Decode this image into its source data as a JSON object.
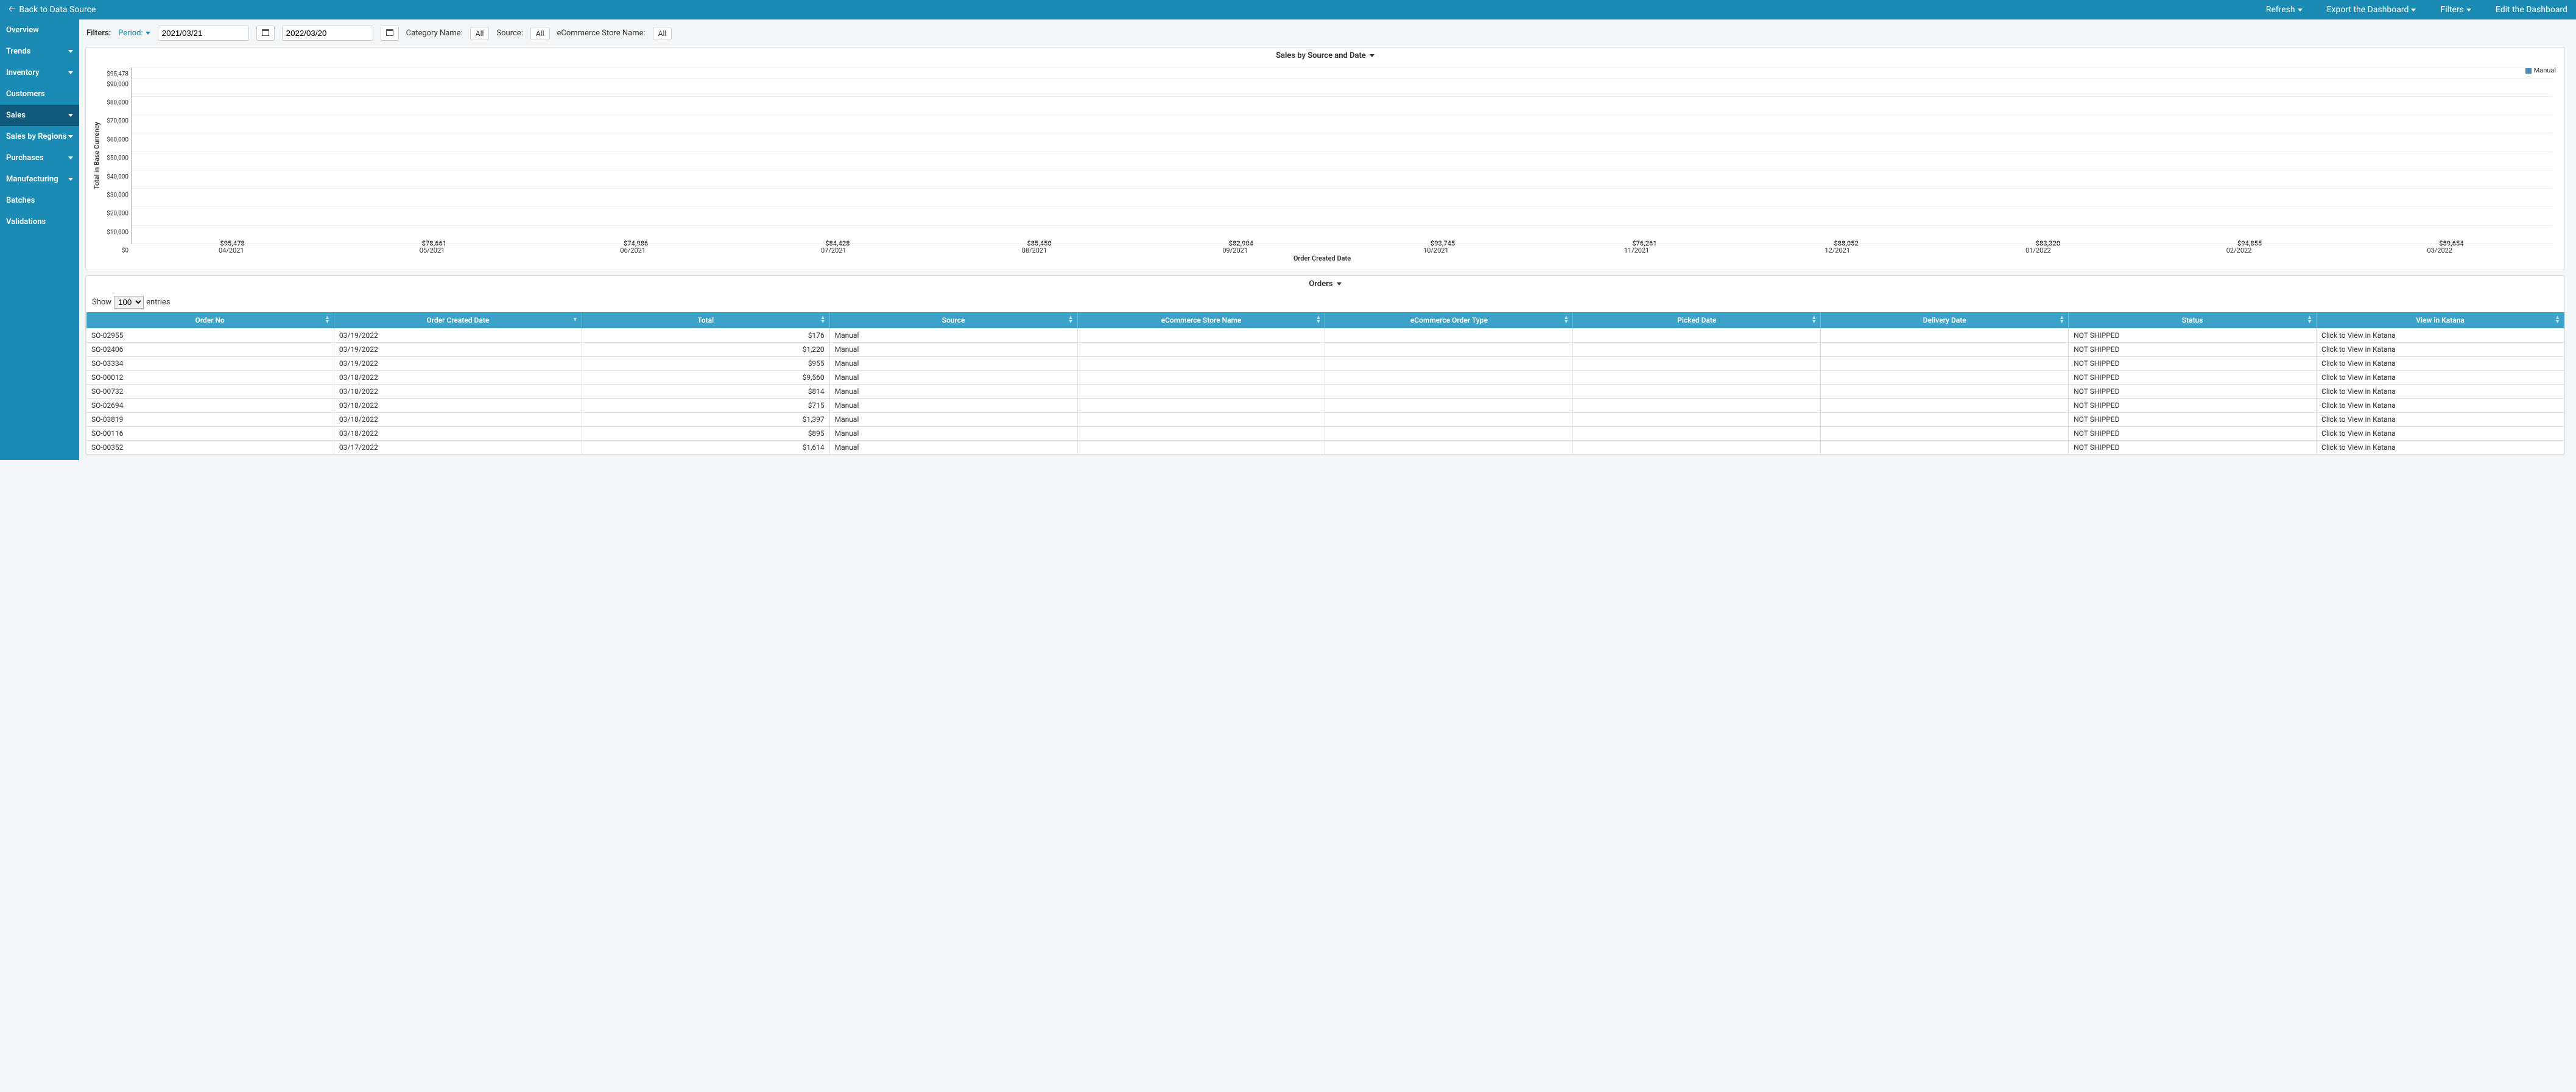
{
  "topbar": {
    "back": "Back to Data Source",
    "refresh": "Refresh",
    "export": "Export the Dashboard",
    "filters": "Filters",
    "edit": "Edit the Dashboard"
  },
  "sidebar": {
    "items": [
      {
        "label": "Overview",
        "caret": false,
        "active": false
      },
      {
        "label": "Trends",
        "caret": true,
        "active": false
      },
      {
        "label": "Inventory",
        "caret": true,
        "active": false
      },
      {
        "label": "Customers",
        "caret": false,
        "active": false
      },
      {
        "label": "Sales",
        "caret": true,
        "active": true
      },
      {
        "label": "Sales by Regions",
        "caret": true,
        "active": false
      },
      {
        "label": "Purchases",
        "caret": true,
        "active": false
      },
      {
        "label": "Manufacturing",
        "caret": true,
        "active": false
      },
      {
        "label": "Batches",
        "caret": false,
        "active": false
      },
      {
        "label": "Validations",
        "caret": false,
        "active": false
      }
    ]
  },
  "filters": {
    "label": "Filters:",
    "period_label": "Period:",
    "date_from": "2021/03/21",
    "date_to": "2022/03/20",
    "category_label": "Category Name:",
    "category_value": "All",
    "source_label": "Source:",
    "source_value": "All",
    "store_label": "eCommerce Store Name:",
    "store_value": "All"
  },
  "chart_panel": {
    "title": "Sales by Source and Date",
    "legend": "Manual",
    "y_label": "Total in Base Currency",
    "x_label": "Order Created Date"
  },
  "chart_data": {
    "type": "bar",
    "categories": [
      "04/2021",
      "05/2021",
      "06/2021",
      "07/2021",
      "08/2021",
      "09/2021",
      "10/2021",
      "11/2021",
      "12/2021",
      "01/2022",
      "02/2022",
      "03/2022"
    ],
    "series": [
      {
        "name": "Manual",
        "values": [
          95478,
          78661,
          74986,
          84428,
          85450,
          82904,
          93745,
          76261,
          88052,
          83320,
          94855,
          59654
        ]
      }
    ],
    "value_labels": [
      "$95,478",
      "$78,661",
      "$74,986",
      "$84,428",
      "$85,450",
      "$82,904",
      "$93,745",
      "$76,261",
      "$88,052",
      "$83,320",
      "$94,855",
      "$59,654"
    ],
    "y_ticks": [
      "$95,478",
      "$90,000",
      "$80,000",
      "$70,000",
      "$60,000",
      "$50,000",
      "$40,000",
      "$30,000",
      "$20,000",
      "$10,000",
      "$0"
    ],
    "ylim": [
      0,
      95478
    ],
    "xlabel": "Order Created Date",
    "ylabel": "Total in Base Currency"
  },
  "orders_panel": {
    "title": "Orders",
    "show_label_pre": "Show",
    "show_value": "100",
    "show_label_post": "entries",
    "columns": [
      "Order No",
      "Order Created Date",
      "Total",
      "Source",
      "eCommerce Store Name",
      "eCommerce Order Type",
      "Picked Date",
      "Delivery Date",
      "Status",
      "View in Katana"
    ],
    "rows": [
      {
        "order_no": "SO-02955",
        "date": "03/19/2022",
        "total": "$176",
        "source": "Manual",
        "store": "",
        "type": "",
        "picked": "",
        "delivery": "",
        "status": "NOT SHIPPED",
        "view": "Click to View in Katana"
      },
      {
        "order_no": "SO-02406",
        "date": "03/19/2022",
        "total": "$1,220",
        "source": "Manual",
        "store": "",
        "type": "",
        "picked": "",
        "delivery": "",
        "status": "NOT SHIPPED",
        "view": "Click to View in Katana"
      },
      {
        "order_no": "SO-03334",
        "date": "03/19/2022",
        "total": "$955",
        "source": "Manual",
        "store": "",
        "type": "",
        "picked": "",
        "delivery": "",
        "status": "NOT SHIPPED",
        "view": "Click to View in Katana"
      },
      {
        "order_no": "SO-00012",
        "date": "03/18/2022",
        "total": "$9,560",
        "source": "Manual",
        "store": "",
        "type": "",
        "picked": "",
        "delivery": "",
        "status": "NOT SHIPPED",
        "view": "Click to View in Katana"
      },
      {
        "order_no": "SO-00732",
        "date": "03/18/2022",
        "total": "$814",
        "source": "Manual",
        "store": "",
        "type": "",
        "picked": "",
        "delivery": "",
        "status": "NOT SHIPPED",
        "view": "Click to View in Katana"
      },
      {
        "order_no": "SO-02694",
        "date": "03/18/2022",
        "total": "$715",
        "source": "Manual",
        "store": "",
        "type": "",
        "picked": "",
        "delivery": "",
        "status": "NOT SHIPPED",
        "view": "Click to View in Katana"
      },
      {
        "order_no": "SO-03819",
        "date": "03/18/2022",
        "total": "$1,397",
        "source": "Manual",
        "store": "",
        "type": "",
        "picked": "",
        "delivery": "",
        "status": "NOT SHIPPED",
        "view": "Click to View in Katana"
      },
      {
        "order_no": "SO-00116",
        "date": "03/18/2022",
        "total": "$895",
        "source": "Manual",
        "store": "",
        "type": "",
        "picked": "",
        "delivery": "",
        "status": "NOT SHIPPED",
        "view": "Click to View in Katana"
      },
      {
        "order_no": "SO-00352",
        "date": "03/17/2022",
        "total": "$1,614",
        "source": "Manual",
        "store": "",
        "type": "",
        "picked": "",
        "delivery": "",
        "status": "NOT SHIPPED",
        "view": "Click to View in Katana"
      }
    ]
  }
}
